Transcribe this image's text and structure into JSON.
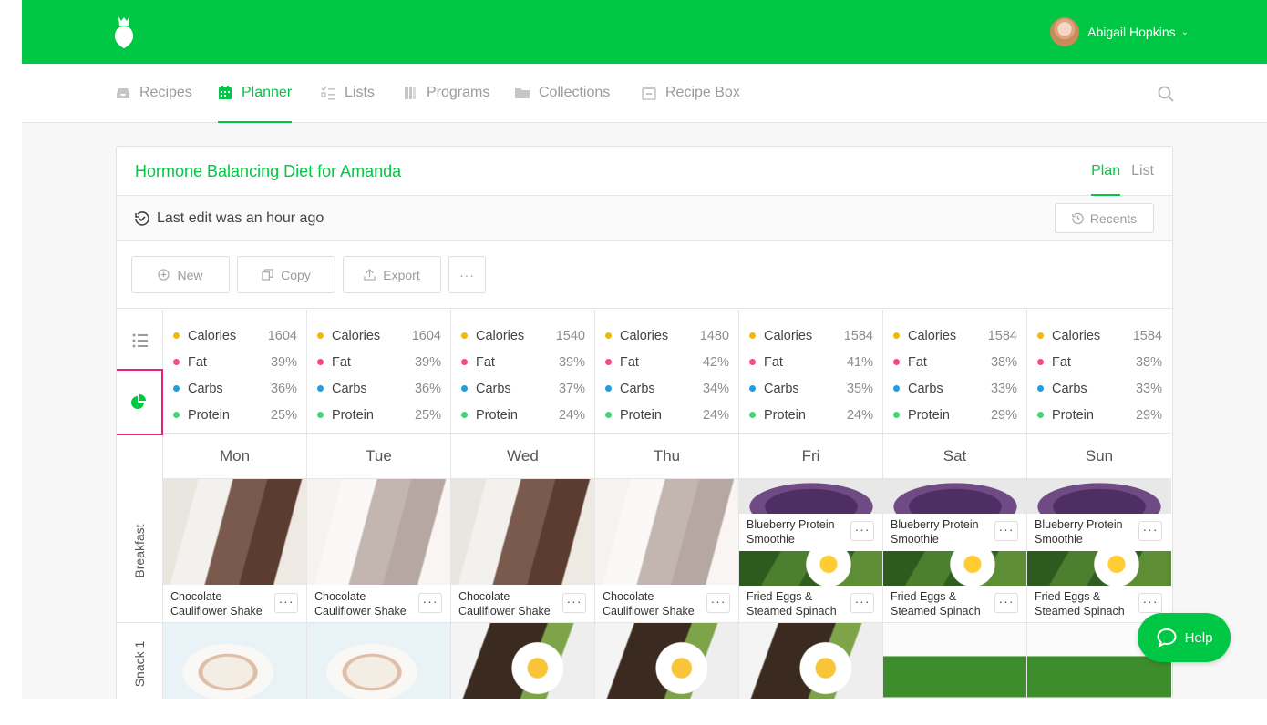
{
  "user": {
    "name": "Abigail Hopkins"
  },
  "nav": {
    "items": [
      {
        "label": "Recipes",
        "active": false
      },
      {
        "label": "Planner",
        "active": true
      },
      {
        "label": "Lists",
        "active": false
      },
      {
        "label": "Programs",
        "active": false
      },
      {
        "label": "Collections",
        "active": false
      },
      {
        "label": "Recipe Box",
        "active": false
      }
    ]
  },
  "plan": {
    "title": "Hormone Balancing Diet for Amanda",
    "views": [
      "Plan",
      "List"
    ],
    "active_view": "Plan",
    "last_edit": "Last edit was an hour ago",
    "recents_label": "Recents"
  },
  "toolbar": {
    "new_label": "New",
    "copy_label": "Copy",
    "export_label": "Export",
    "more_label": "···"
  },
  "colors": {
    "brand": "#00c844",
    "calories": "#f5b800",
    "fat": "#ef4b8a",
    "carbs": "#1aa0e0",
    "protein": "#4cd07a",
    "highlight": "#e5207d"
  },
  "macro_labels": [
    "Calories",
    "Fat",
    "Carbs",
    "Protein"
  ],
  "days": [
    {
      "name": "Mon",
      "calories": "1604",
      "fat": "39%",
      "carbs": "36%",
      "protein": "25%"
    },
    {
      "name": "Tue",
      "calories": "1604",
      "fat": "39%",
      "carbs": "36%",
      "protein": "25%"
    },
    {
      "name": "Wed",
      "calories": "1540",
      "fat": "39%",
      "carbs": "37%",
      "protein": "24%"
    },
    {
      "name": "Thu",
      "calories": "1480",
      "fat": "42%",
      "carbs": "34%",
      "protein": "24%"
    },
    {
      "name": "Fri",
      "calories": "1584",
      "fat": "41%",
      "carbs": "35%",
      "protein": "24%"
    },
    {
      "name": "Sat",
      "calories": "1584",
      "fat": "38%",
      "carbs": "33%",
      "protein": "29%"
    },
    {
      "name": "Sun",
      "calories": "1584",
      "fat": "38%",
      "carbs": "33%",
      "protein": "29%"
    }
  ],
  "meals": {
    "breakfast_label": "Breakfast",
    "snack_label": "Snack 1",
    "recipes": {
      "shake": "Chocolate Cauliflower Shake",
      "smoothie": "Blueberry Protein Smoothie",
      "eggs": "Fried Eggs & Steamed Spinach"
    }
  },
  "help": {
    "label": "Help"
  }
}
